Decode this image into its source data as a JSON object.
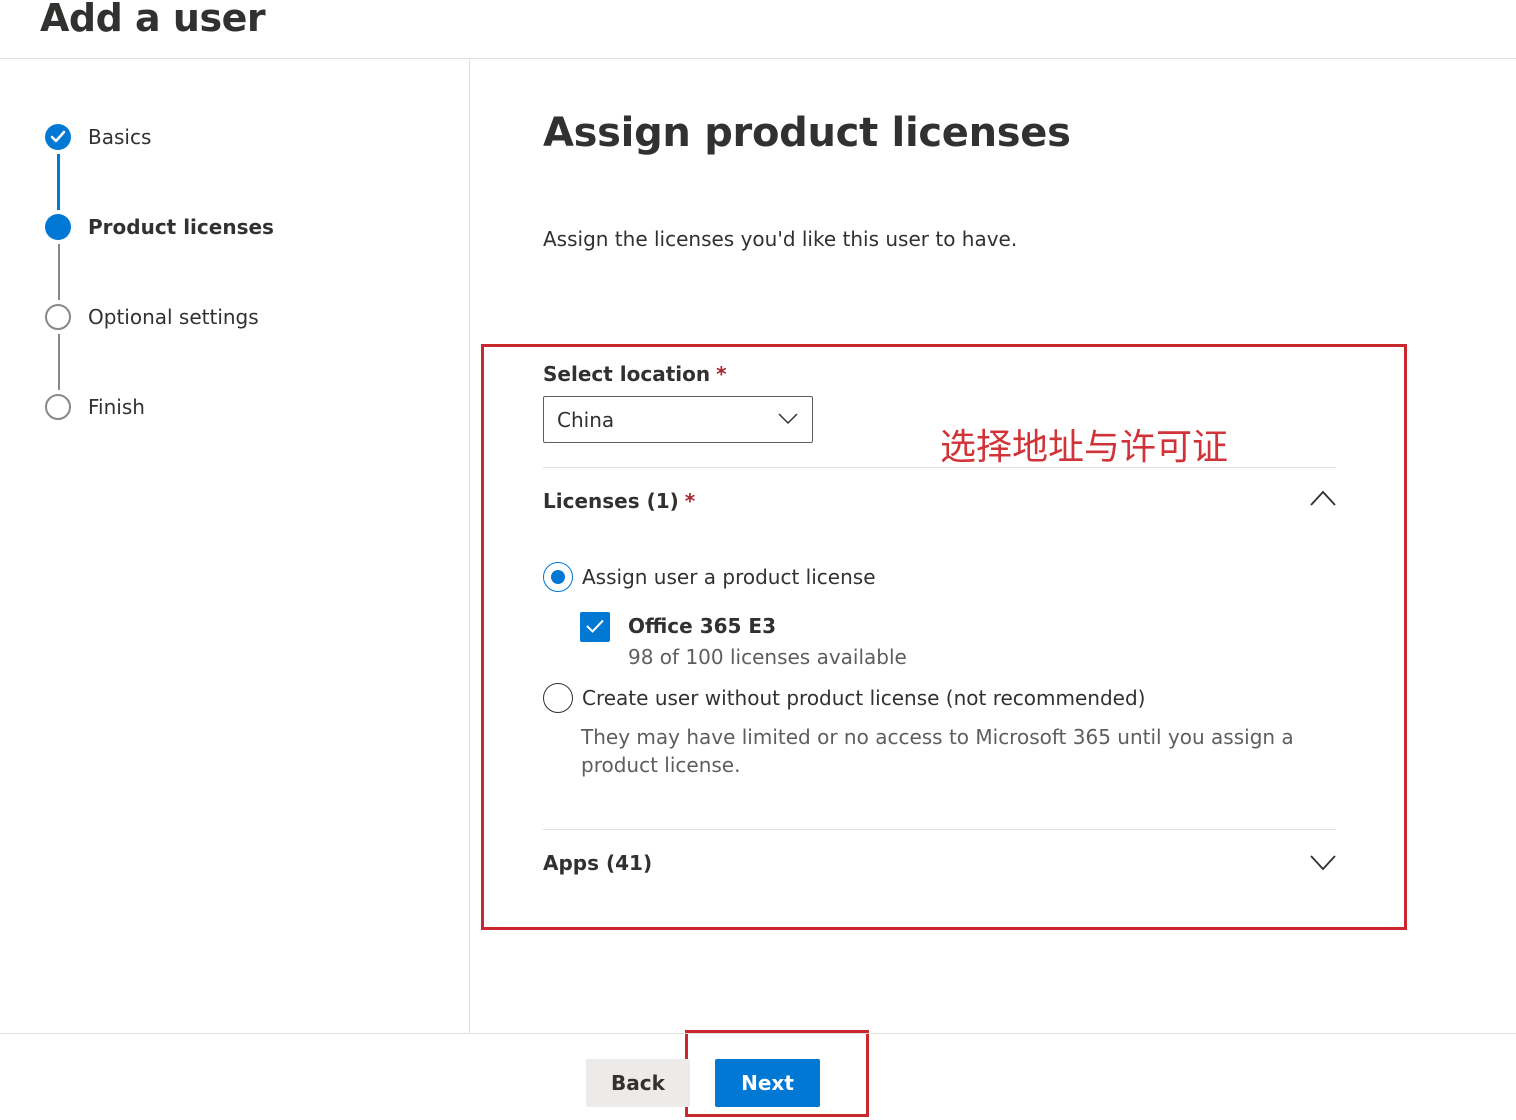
{
  "header": {
    "title": "Add a user"
  },
  "stepper": {
    "steps": [
      {
        "label": "Basics",
        "state": "done"
      },
      {
        "label": "Product licenses",
        "state": "current"
      },
      {
        "label": "Optional settings",
        "state": "pending"
      },
      {
        "label": "Finish",
        "state": "pending"
      }
    ]
  },
  "main": {
    "title": "Assign product licenses",
    "description": "Assign the licenses you'd like this user to have.",
    "location": {
      "label": "Select location",
      "required_mark": "*",
      "value": "China"
    },
    "annotation": "选择地址与许可证",
    "licenses": {
      "header": "Licenses (1)",
      "required_mark": "*",
      "expanded": true,
      "assign_option": {
        "label": "Assign user a product license",
        "selected": true
      },
      "products": [
        {
          "name": "Office 365 E3",
          "availability": "98 of 100 licenses available",
          "checked": true
        }
      ],
      "no_license_option": {
        "label": "Create user without product license (not recommended)",
        "selected": false,
        "note": "They may have limited or no access to Microsoft 365 until you assign a product license."
      }
    },
    "apps": {
      "header": "Apps (41)",
      "expanded": false
    }
  },
  "footer": {
    "back_label": "Back",
    "next_label": "Next"
  },
  "colors": {
    "accent": "#0078d4",
    "annotation_red": "#d13438",
    "text": "#323130"
  }
}
